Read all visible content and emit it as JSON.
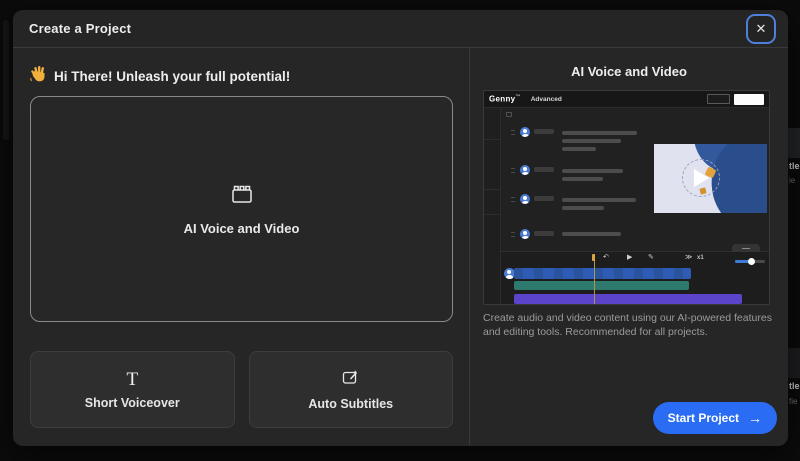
{
  "modal": {
    "title": "Create a Project"
  },
  "icons": {
    "close": "✕",
    "wave": "waving-hand-emoji",
    "clapperboard": "clapperboard-outline",
    "text_tool": "T",
    "subtitles": "subtitle-edit-square",
    "undo": "↶",
    "play": "▶",
    "edit": "✎",
    "skip": "≫",
    "arrow_right": "→"
  },
  "left_pane": {
    "greeting": "Hi There! Unleash your full potential!",
    "primary_card": {
      "label": "AI Voice and Video"
    },
    "cards": [
      {
        "label": "Short Voiceover"
      },
      {
        "label": "Auto Subtitles"
      }
    ]
  },
  "right_pane": {
    "heading": "AI Voice and Video",
    "preview": {
      "logo": "Genny",
      "trademark": "™",
      "nav": "Advanced",
      "playback_rate": "x1"
    },
    "description": "Create audio and video content using our AI-powered features and editing tools. Recommended for all projects.",
    "start_button": "Start Project"
  },
  "background_page": {
    "card1": {
      "title_fragment": "tle",
      "subtitle_fragment": "ie"
    },
    "card2": {
      "title_fragment": "tle",
      "subtitle_fragment": "fie"
    }
  },
  "colors": {
    "accent_blue": "#2a6df4",
    "focus_ring": "#4e7fd9",
    "track_blue": "#2e5cb5",
    "track_teal": "#2f7a6e",
    "track_purple": "#5b44c9",
    "playhead_orange": "#dca43e",
    "modal_bg": "#262626"
  }
}
